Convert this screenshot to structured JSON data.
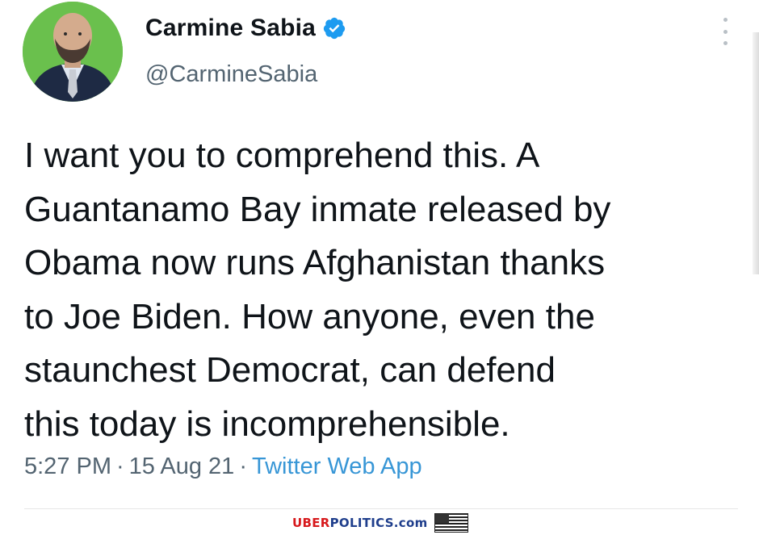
{
  "tweet": {
    "author": {
      "display_name": "Carmine Sabia",
      "handle": "@CarmineSabia",
      "verified": true,
      "avatar_icon": "profile-photo"
    },
    "text_lines": [
      "I want you to comprehend this. A",
      "Guantanamo Bay inmate released by",
      "Obama now runs Afghanistan thanks",
      "to Joe Biden. How anyone, even the",
      "staunchest Democrat, can defend",
      "this today is incomprehensible."
    ],
    "meta": {
      "time": "5:27 PM",
      "date": "15 Aug 21",
      "source": "Twitter Web App",
      "separator": "·"
    },
    "more_icon": "more-vertical-icon"
  },
  "watermark": {
    "part_red": "UBER",
    "part_blue": "POLITICS.com",
    "flag_icon": "us-flag-icon"
  },
  "colors": {
    "text_primary": "#0f1419",
    "text_secondary": "#536471",
    "link": "#1d9bf0",
    "verified": "#1d9bf0",
    "avatar_bg": "#6ac04d"
  }
}
